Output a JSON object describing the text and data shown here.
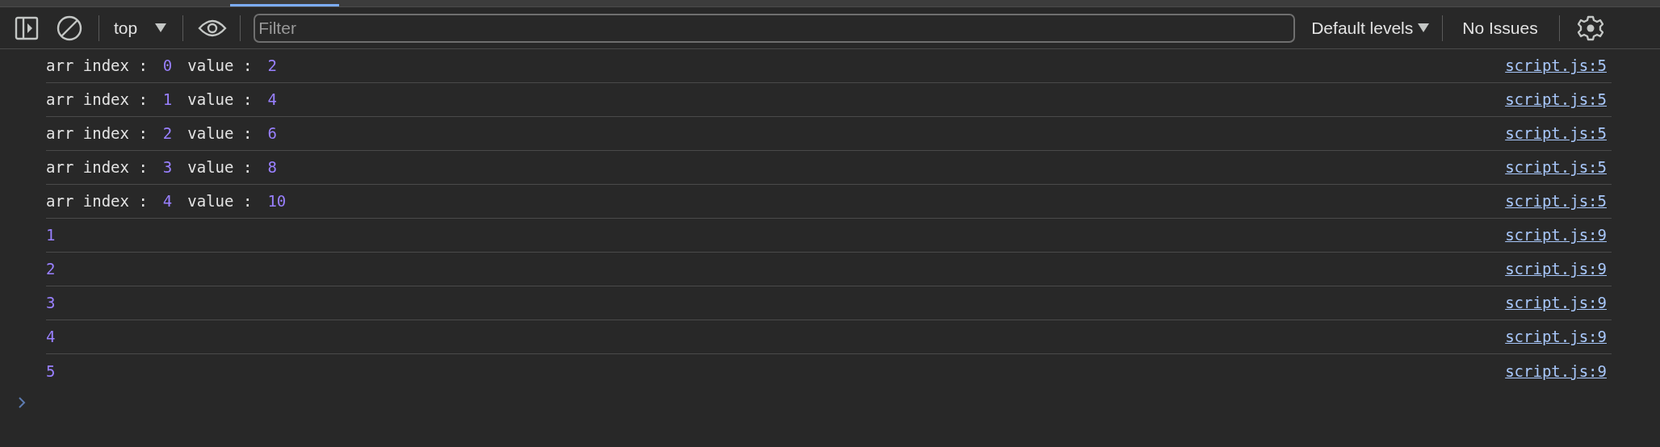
{
  "toolbar": {
    "context": "top",
    "filter": {
      "placeholder": "Filter"
    },
    "levels": "Default levels",
    "issues": "No Issues"
  },
  "messages": [
    {
      "parts": [
        {
          "kind": "string",
          "text": "arr index :"
        },
        {
          "kind": "number",
          "text": "0"
        },
        {
          "kind": "string",
          "text": "value :"
        },
        {
          "kind": "number",
          "text": "2"
        }
      ],
      "source": "script.js:5"
    },
    {
      "parts": [
        {
          "kind": "string",
          "text": "arr index :"
        },
        {
          "kind": "number",
          "text": "1"
        },
        {
          "kind": "string",
          "text": "value :"
        },
        {
          "kind": "number",
          "text": "4"
        }
      ],
      "source": "script.js:5"
    },
    {
      "parts": [
        {
          "kind": "string",
          "text": "arr index :"
        },
        {
          "kind": "number",
          "text": "2"
        },
        {
          "kind": "string",
          "text": "value :"
        },
        {
          "kind": "number",
          "text": "6"
        }
      ],
      "source": "script.js:5"
    },
    {
      "parts": [
        {
          "kind": "string",
          "text": "arr index :"
        },
        {
          "kind": "number",
          "text": "3"
        },
        {
          "kind": "string",
          "text": "value :"
        },
        {
          "kind": "number",
          "text": "8"
        }
      ],
      "source": "script.js:5"
    },
    {
      "parts": [
        {
          "kind": "string",
          "text": "arr index :"
        },
        {
          "kind": "number",
          "text": "4"
        },
        {
          "kind": "string",
          "text": "value :"
        },
        {
          "kind": "number",
          "text": "10"
        }
      ],
      "source": "script.js:5"
    },
    {
      "parts": [
        {
          "kind": "number",
          "text": "1"
        }
      ],
      "source": "script.js:9"
    },
    {
      "parts": [
        {
          "kind": "number",
          "text": "2"
        }
      ],
      "source": "script.js:9"
    },
    {
      "parts": [
        {
          "kind": "number",
          "text": "3"
        }
      ],
      "source": "script.js:9"
    },
    {
      "parts": [
        {
          "kind": "number",
          "text": "4"
        }
      ],
      "source": "script.js:9"
    },
    {
      "parts": [
        {
          "kind": "number",
          "text": "5"
        }
      ],
      "source": "script.js:9"
    }
  ]
}
